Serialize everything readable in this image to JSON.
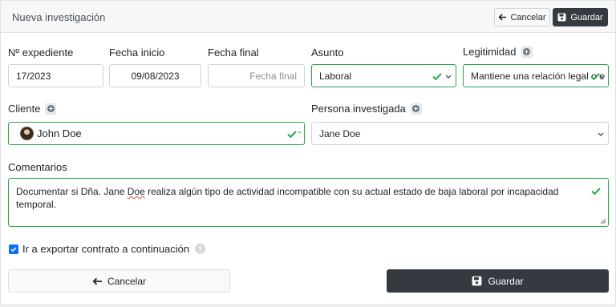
{
  "header": {
    "title": "Nueva investigación",
    "cancel_label": "Cancelar",
    "save_label": "Guardar"
  },
  "fields": {
    "expediente": {
      "label": "Nº expediente",
      "value": "17/2023"
    },
    "fecha_inicio": {
      "label": "Fecha inicio",
      "value": "09/08/2023"
    },
    "fecha_final": {
      "label": "Fecha final",
      "placeholder": "Fecha final"
    },
    "asunto": {
      "label": "Asunto",
      "value": "Laboral"
    },
    "legitimidad": {
      "label": "Legitimidad",
      "value": "Mantiene una relación legal o c"
    },
    "cliente": {
      "label": "Cliente",
      "value": "John Doe"
    },
    "persona": {
      "label": "Persona investigada",
      "value": "Jane Doe"
    },
    "comentarios": {
      "label": "Comentarios",
      "value_before": "Documentar si Dña. Jane ",
      "value_flagged": "Doe",
      "value_after": " realiza algún tipo de actividad incompatible con su actual estado de baja laboral por incapacidad temporal."
    }
  },
  "export_contract": {
    "label": "Ir a exportar contrato a continuación",
    "checked": true
  },
  "footer": {
    "cancel_label": "Cancelar",
    "save_label": "Guardar"
  },
  "colors": {
    "valid": "#28a745",
    "dark_button": "#343a40",
    "checkbox": "#0d6efd"
  }
}
